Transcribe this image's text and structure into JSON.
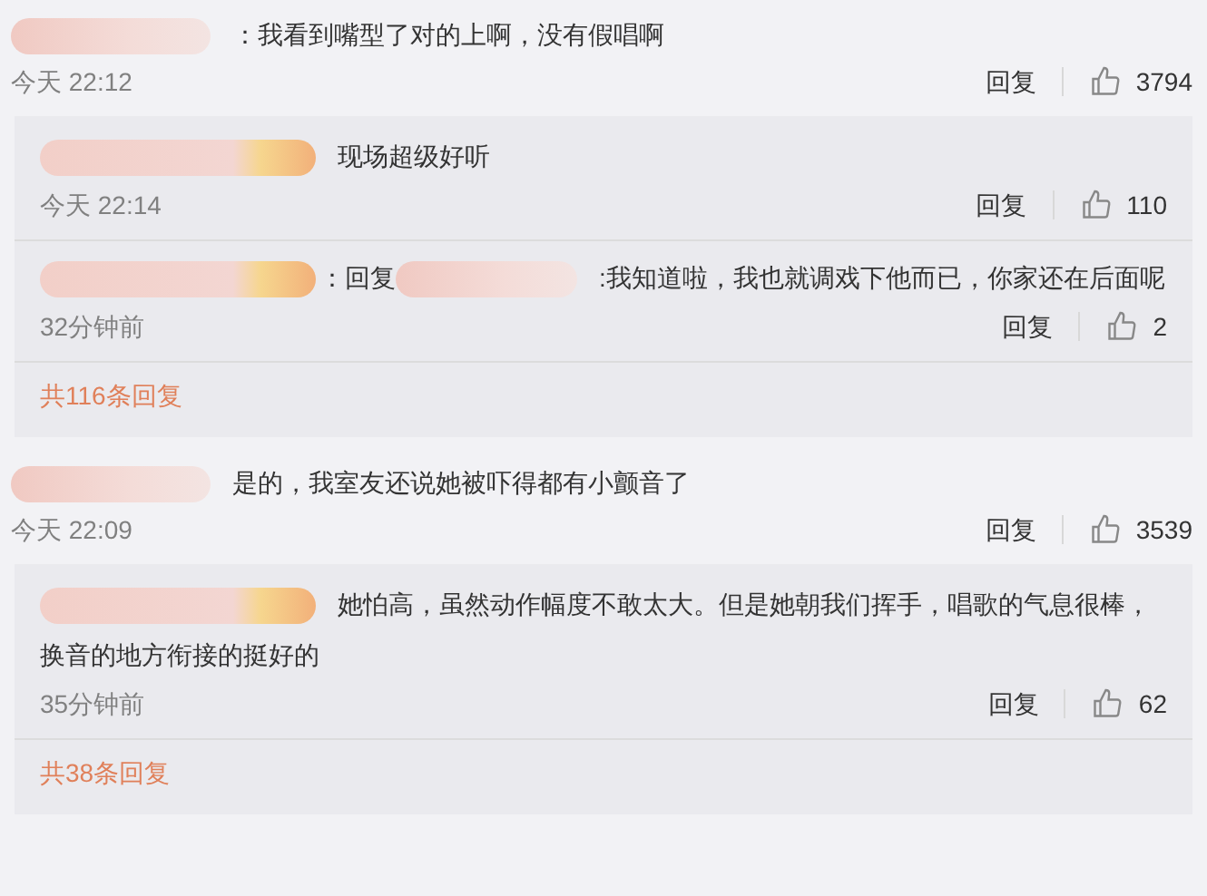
{
  "comments": [
    {
      "text": "：我看到嘴型了对的上啊，没有假唱啊",
      "time": "今天 22:12",
      "reply_label": "回复",
      "likes": "3794",
      "replies": [
        {
          "text": "现场超级好听",
          "time": "今天 22:14",
          "reply_label": "回复",
          "likes": "110"
        },
        {
          "prefix": "：回复",
          "text": ":我知道啦，我也就调戏下他而已，你家还在后面呢",
          "time": "32分钟前",
          "reply_label": "回复",
          "likes": "2"
        }
      ],
      "more_replies": "共116条回复"
    },
    {
      "text": "是的，我室友还说她被吓得都有小颤音了",
      "time": "今天 22:09",
      "reply_label": "回复",
      "likes": "3539",
      "replies": [
        {
          "text": "她怕高，虽然动作幅度不敢太大。但是她朝我们挥手，唱歌的气息很棒，换音的地方衔接的挺好的",
          "time": "35分钟前",
          "reply_label": "回复",
          "likes": "62"
        }
      ],
      "more_replies": "共38条回复"
    }
  ]
}
